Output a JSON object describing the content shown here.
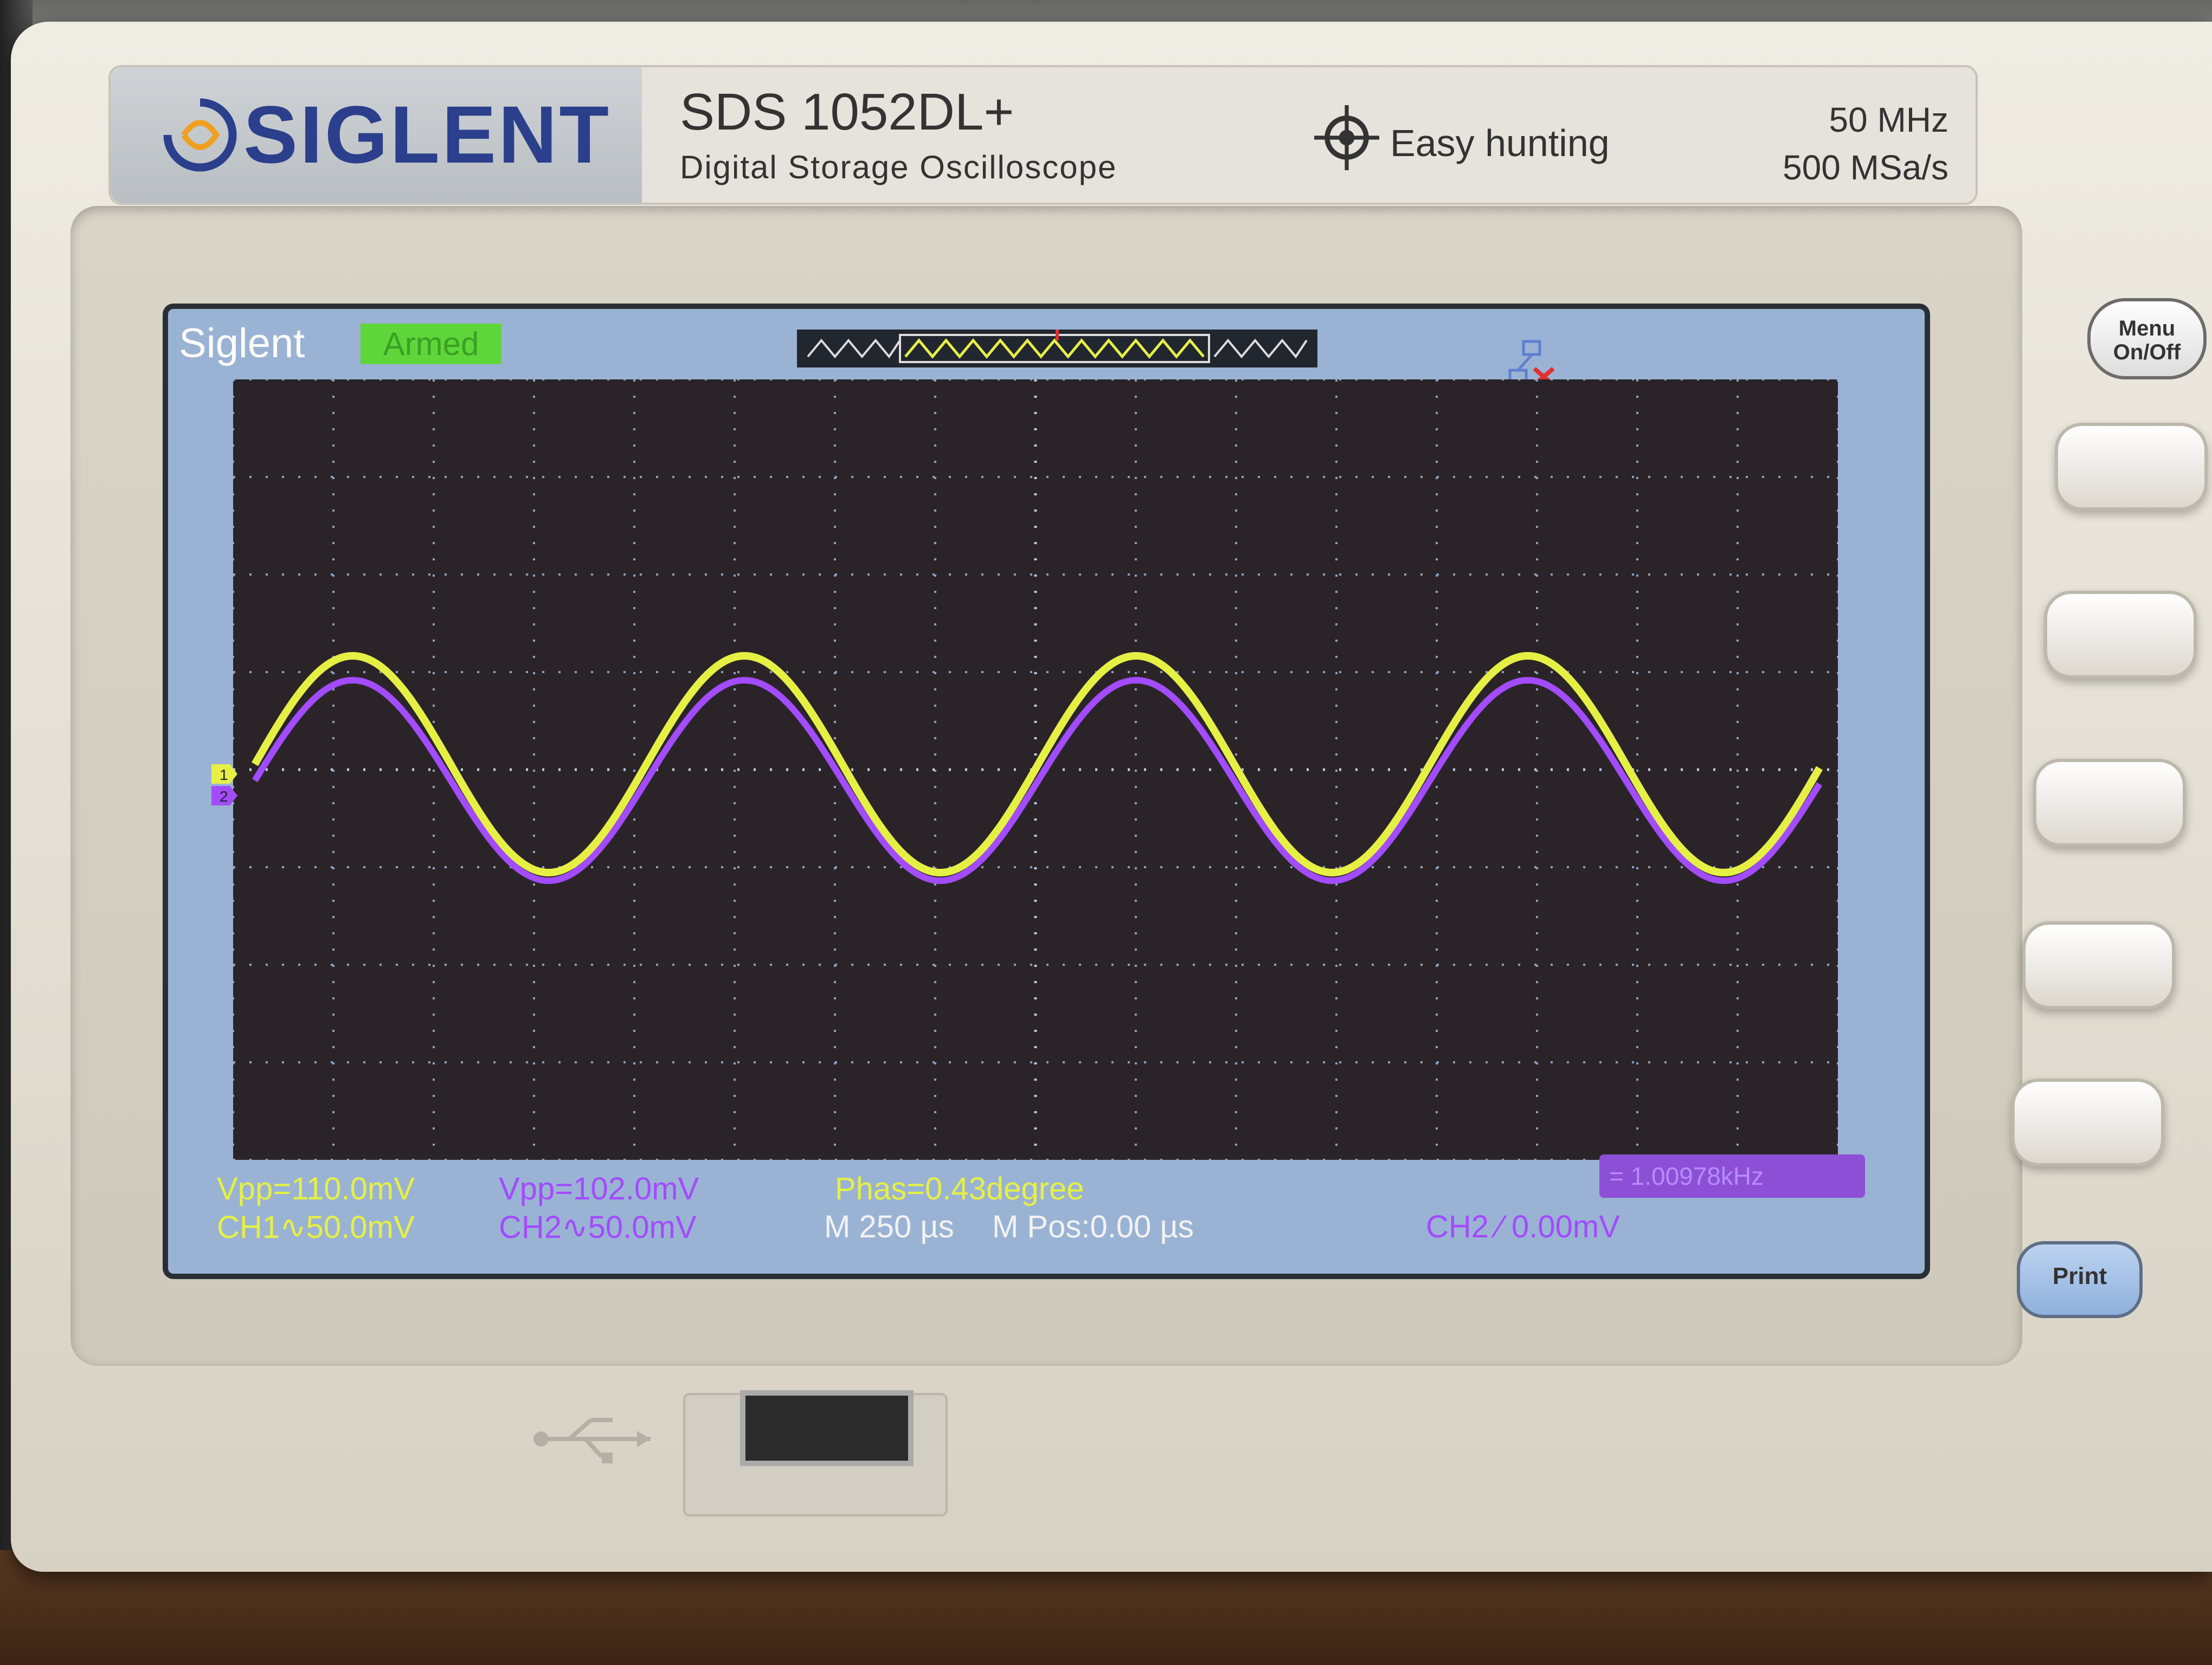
{
  "header": {
    "brand_logo": "SIGLENT",
    "model": "SDS 1052DL+",
    "subtitle": "Digital Storage Oscilloscope",
    "feature": "Easy hunting",
    "bandwidth": "50 MHz",
    "sample_rate": "500 MSa/s"
  },
  "screen": {
    "brand": "Siglent",
    "status": "Armed",
    "ch1_marker": "1",
    "ch2_marker": "2",
    "trigger_marker": "T"
  },
  "measurements": {
    "ch1_vpp": "Vpp=110.0mV",
    "ch2_vpp": "Vpp=102.0mV",
    "phase": "Phas=0.43degree",
    "ch1_scale": "CH1∿50.0mV",
    "ch2_scale": "CH2∿50.0mV",
    "timebase": "M 250 µs",
    "mpos": "M Pos:0.00 µs",
    "trigger": "CH2 ⁄ 0.00mV",
    "frequency": "= 1.00978kHz"
  },
  "buttons": {
    "menu": "Menu On/Off",
    "print": "Print"
  },
  "colors": {
    "ch1": "#e6f044",
    "ch2": "#a24bff",
    "grid_bg": "#2a2428",
    "screen_frame": "#9ab3d4"
  },
  "icons": [
    "siglent-logo-icon",
    "crosshair-icon",
    "network-icon",
    "usb-icon",
    "trigger-marker-icon"
  ]
}
